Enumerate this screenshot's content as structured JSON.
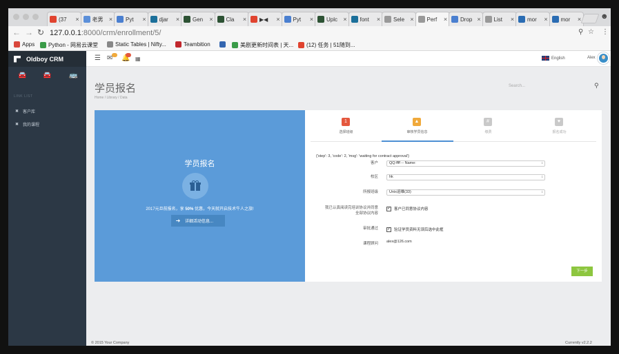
{
  "browser": {
    "tabs": [
      {
        "label": "(37",
        "color": "#e0432f"
      },
      {
        "label": "老男",
        "color": "#5b8fd9"
      },
      {
        "label": "Pyt",
        "color": "#4a7fd0"
      },
      {
        "label": "djar",
        "color": "#1b6f9a"
      },
      {
        "label": "Gen",
        "color": "#2d5234"
      },
      {
        "label": "Cla",
        "color": "#2d5234"
      },
      {
        "label": "▶◀",
        "color": "#e0432f"
      },
      {
        "label": "Pyt",
        "color": "#4a7fd0"
      },
      {
        "label": "Uplc",
        "color": "#2d5234"
      },
      {
        "label": "font",
        "color": "#1b6f9a"
      },
      {
        "label": "Sele",
        "color": "#999999"
      },
      {
        "label": "Perf",
        "color": "#999999"
      },
      {
        "label": "Drop",
        "color": "#4a7fd0"
      },
      {
        "label": "List",
        "color": "#999999"
      },
      {
        "label": "mor",
        "color": "#2a6cb3"
      },
      {
        "label": "mor",
        "color": "#2a6cb3"
      }
    ],
    "url_host": "127.0.0.1",
    "url_path": ":8000/crm/enrollment/5/",
    "bookmarks": [
      {
        "label": "Apps",
        "color": "#d9473b"
      },
      {
        "label": "Python - 网易云课堂",
        "color": "#3a9b48"
      },
      {
        "label": "Static Tables | Nifty...",
        "color": "#888888"
      },
      {
        "label": "Teambition",
        "color": "#c1272d"
      },
      {
        "label": "",
        "color": "#3466b0"
      },
      {
        "label": "美剧更新时间表 | 天...",
        "color": "#3a9b48"
      },
      {
        "label": "(12) 任务 | 51随到...",
        "color": "#e0432f"
      }
    ]
  },
  "sidebar": {
    "brand": "Oldboy CRM",
    "section": "LINK LIST",
    "items": [
      {
        "label": "客户库"
      },
      {
        "label": "我的课程"
      }
    ]
  },
  "topbar": {
    "badges": [
      "",
      ""
    ],
    "language": "English",
    "user": "Alex"
  },
  "page": {
    "title": "学员报名",
    "breadcrumb": "Home  /  Library  /  Data",
    "search_placeholder": "Search..."
  },
  "hero": {
    "title": "学员报名",
    "promo_before": "2017元旦前报名，享 ",
    "promo_bold": "50%",
    "promo_after": " 优惠，今天就开启技术牛人之旅!",
    "button_label": "详细活动信息..."
  },
  "steps": [
    {
      "label": "选择班级",
      "color": "#e4573d"
    },
    {
      "label": "审核学员信息",
      "color": "#f0a93b"
    },
    {
      "label": "缴费",
      "color": "#c9c9c9"
    },
    {
      "label": "报名成功",
      "color": "#c9c9c9"
    }
  ],
  "form": {
    "status": "{'step': 3, 'code': 2, 'msg': 'waiting for contract approval'}",
    "customer_label": "客户",
    "customer_value": "QQ:ffff -- Name:",
    "school_label": "校区",
    "school_value": "hk",
    "class_label": "所报班级",
    "class_value": "Unix运维(33)",
    "agreement_label_1": "我已认真阅读完培训协议并同意",
    "agreement_label_2": "全部协议内容",
    "agreement_check": "客户已同意协议内容",
    "review_label": "审批通过",
    "review_check": "验证学员资料无误后选中此框",
    "consultant_label": "课程顾问",
    "consultant_value": "alex@126.com",
    "next_label": "下一步"
  },
  "footer": {
    "left": "© 2015 Your Company",
    "right": "Currently v2.2.2"
  }
}
